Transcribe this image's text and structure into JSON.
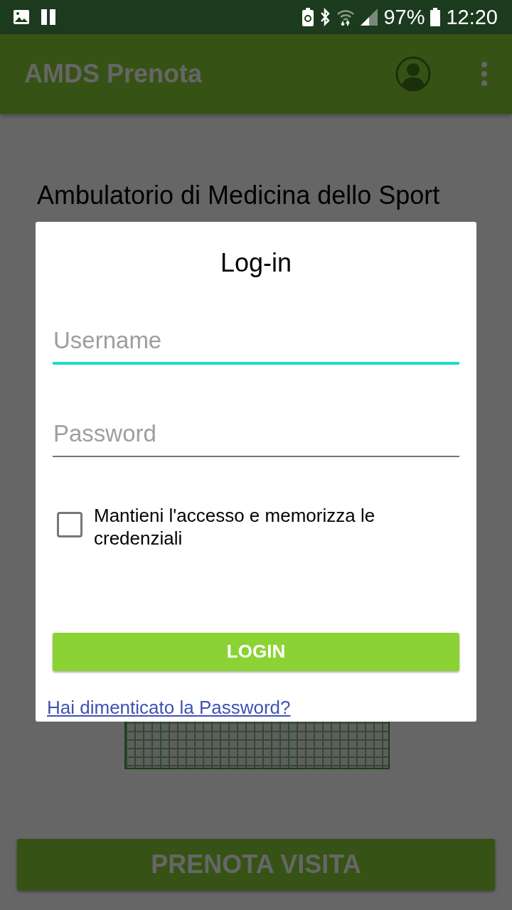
{
  "status_bar": {
    "battery": "97%",
    "time": "12:20"
  },
  "app_bar": {
    "title": "AMDS Prenota"
  },
  "content": {
    "heading": "Ambulatorio di Medicina dello Sport"
  },
  "dialog": {
    "title": "Log-in",
    "fields": [
      {
        "placeholder": "Username",
        "focused": true
      },
      {
        "placeholder": "Password",
        "focused": false
      }
    ],
    "remember": {
      "label": "Mantieni l'accesso e memorizza le credenziali",
      "checked": false
    },
    "login_button": "LOGIN",
    "forgot_link": "Hai dimenticato la Password?"
  },
  "bottom_button": "PRENOTA VISITA"
}
